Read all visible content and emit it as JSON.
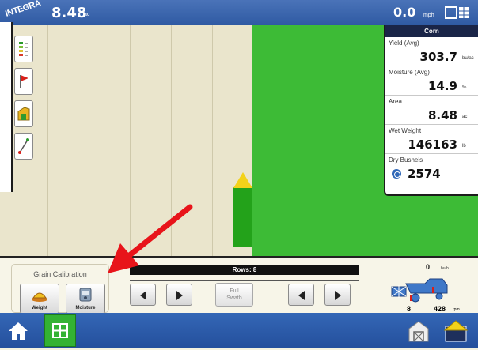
{
  "topbar": {
    "logo_text": "INTEGRA",
    "area_value": "8.48",
    "area_unit": "ac",
    "speed_value": "0.0",
    "speed_unit": "mph"
  },
  "panel": {
    "crop": "Corn",
    "readings": [
      {
        "label": "Yield (Avg)",
        "value": "303.7",
        "unit": "bu/ac"
      },
      {
        "label": "Moisture (Avg)",
        "value": "14.9",
        "unit": "%"
      },
      {
        "label": "Area",
        "value": "8.48",
        "unit": "ac"
      },
      {
        "label": "Wet Weight",
        "value": "146163",
        "unit": "lb"
      },
      {
        "label": "Dry Bushels",
        "value": "2574",
        "unit": ""
      }
    ]
  },
  "grain_calibration": {
    "title": "Grain Calibration",
    "weight_label": "Weight",
    "moisture_label": "Moisture"
  },
  "rows": {
    "label": "Rows: 8",
    "full_swath_line1": "Full",
    "full_swath_line2": "Swath"
  },
  "combine": {
    "flow_value": "0",
    "flow_unit": "bu/h",
    "rows": "8",
    "rpm_value": "428",
    "rpm_unit": "rpm"
  },
  "colors": {
    "field_green": "#3dbb36",
    "unharvested": "#eae5cc",
    "header_blue": "#2f5aa3",
    "annotation_red": "#e8141a"
  }
}
